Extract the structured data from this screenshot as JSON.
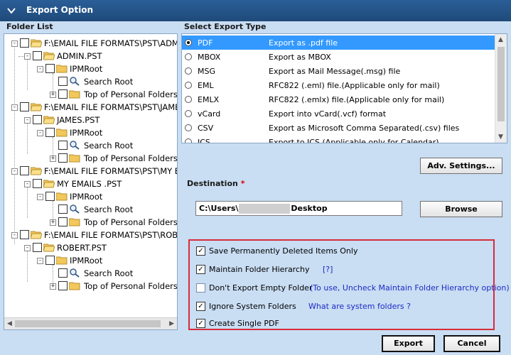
{
  "window": {
    "title": "Export Option"
  },
  "folder_list": {
    "label": "Folder List",
    "groups": [
      {
        "path": "F:\\EMAIL FILE FORMATS\\PST\\ADM",
        "pst": "ADMIN.PST",
        "root": "IPMRoot",
        "search": "Search Root",
        "top": "Top of Personal Folders"
      },
      {
        "path": "F:\\EMAIL FILE FORMATS\\PST\\JAME",
        "pst": "JAMES.PST",
        "root": "IPMRoot",
        "search": "Search Root",
        "top": "Top of Personal Folders"
      },
      {
        "path": "F:\\EMAIL FILE FORMATS\\PST\\MY E",
        "pst": "MY EMAILS .PST",
        "root": "IPMRoot",
        "search": "Search Root",
        "top": "Top of Personal Folders"
      },
      {
        "path": "F:\\EMAIL FILE FORMATS\\PST\\ROBE",
        "pst": "ROBERT.PST",
        "root": "IPMRoot",
        "search": "Search Root",
        "top": "Top of Personal Folders"
      }
    ]
  },
  "export_type": {
    "label": "Select Export Type",
    "selected": "PDF",
    "items": [
      {
        "name": "PDF",
        "desc": "Export as .pdf file"
      },
      {
        "name": "MBOX",
        "desc": "Export as MBOX"
      },
      {
        "name": "MSG",
        "desc": "Export as Mail Message(.msg) file"
      },
      {
        "name": "EML",
        "desc": "RFC822 (.eml) file.(Applicable only for mail)"
      },
      {
        "name": "EMLX",
        "desc": "RFC822 (.emlx) file.(Applicable only for mail)"
      },
      {
        "name": "vCard",
        "desc": "Export into vCard(.vcf) format"
      },
      {
        "name": "CSV",
        "desc": "Export as Microsoft Comma Separated(.csv) files"
      },
      {
        "name": "ICS",
        "desc": "Export to ICS (Applicable only for Calendar)"
      }
    ]
  },
  "adv_settings_label": "Adv. Settings...",
  "destination": {
    "label": "Destination",
    "required_mark": "*",
    "value_prefix": "C:\\Users\\",
    "value_suffix": "Desktop",
    "browse_label": "Browse"
  },
  "options": [
    {
      "label": "Save Permanently Deleted Items Only",
      "checked": true,
      "link": ""
    },
    {
      "label": "Maintain Folder Hierarchy",
      "checked": true,
      "link": "[?]"
    },
    {
      "label": "Don't Export Empty Folder",
      "checked": false,
      "link": "(To use, Uncheck Maintain Folder Hierarchy option)"
    },
    {
      "label": "Ignore System Folders",
      "checked": true,
      "link": "What are system folders ?"
    },
    {
      "label": "Create Single PDF",
      "checked": true,
      "link": ""
    }
  ],
  "footer": {
    "export_label": "Export",
    "cancel_label": "Cancel"
  },
  "colors": {
    "titlebar": "#2a5e97",
    "background": "#c9ddf3",
    "selection": "#3399ff",
    "highlight_box": "#d62d3a",
    "link": "#1c2bc4"
  }
}
